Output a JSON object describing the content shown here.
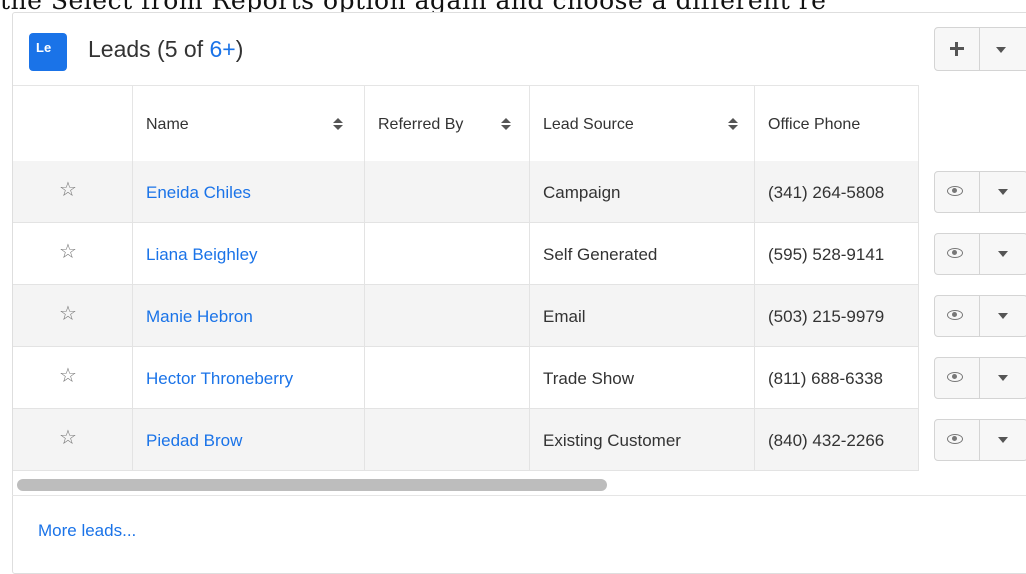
{
  "top_text": "the Select from Reports option again and choose a different re",
  "dashlet": {
    "module_badge": "Le",
    "title_prefix": "Leads (5 of ",
    "title_link": "6+",
    "title_suffix": ")"
  },
  "table": {
    "columns": [
      "Name",
      "Referred By",
      "Lead Source",
      "Office Phone"
    ],
    "rows": [
      {
        "name": "Eneida Chiles",
        "referred_by": "",
        "lead_source": "Campaign",
        "office_phone": "(341) 264-5808"
      },
      {
        "name": "Liana Beighley",
        "referred_by": "",
        "lead_source": "Self Generated",
        "office_phone": "(595) 528-9141"
      },
      {
        "name": "Manie Hebron",
        "referred_by": "",
        "lead_source": "Email",
        "office_phone": "(503) 215-9979"
      },
      {
        "name": "Hector Throneberry",
        "referred_by": "",
        "lead_source": "Trade Show",
        "office_phone": "(811) 688-6338"
      },
      {
        "name": "Piedad Brow",
        "referred_by": "",
        "lead_source": "Existing Customer",
        "office_phone": "(840) 432-2266"
      }
    ]
  },
  "footer": {
    "more_link": "More leads..."
  },
  "icons": {
    "favorite": "star-outline-icon",
    "preview": "eye-icon",
    "dropdown": "caret-down-icon",
    "add": "plus-icon",
    "sort": "sort-icon"
  },
  "colors": {
    "accent": "#1a73e8",
    "badge_bg": "#1a73e8",
    "row_stripe": "#f4f4f4",
    "border": "#e3e3e3"
  }
}
